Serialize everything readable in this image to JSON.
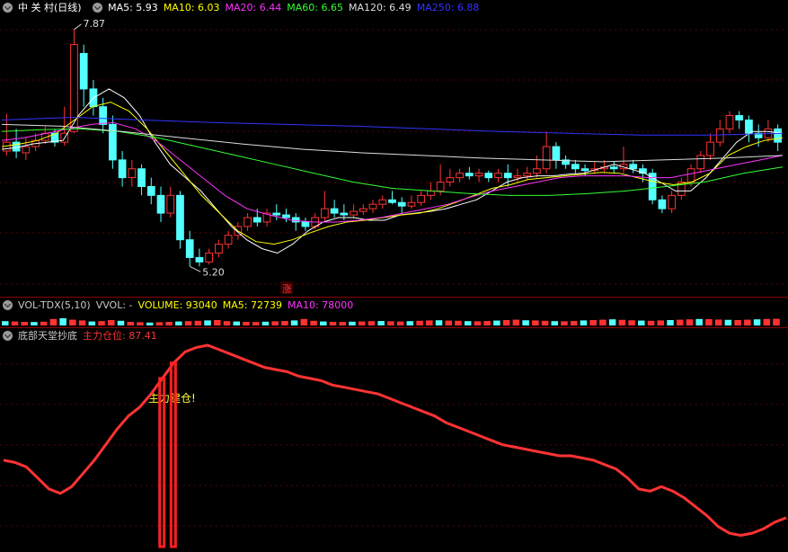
{
  "header": {
    "stock_name": "中 关 村",
    "period": "(日线)",
    "ma": [
      {
        "label": "MA5: 5.93",
        "color": "#ffffff"
      },
      {
        "label": "MA10: 6.03",
        "color": "#ffff00"
      },
      {
        "label": "MA20: 6.44",
        "color": "#ff33ff"
      },
      {
        "label": "MA60: 6.65",
        "color": "#33ff33"
      },
      {
        "label": "MA120: 6.49",
        "color": "#dddddd"
      },
      {
        "label": "MA250: 6.88",
        "color": "#3333ff"
      }
    ]
  },
  "volume_header": {
    "name": "VOL-TDX(5,10)",
    "vvol": "VVOL: -",
    "volume": "VOLUME: 93040",
    "ma5": "MA5: 72739",
    "ma10": "MA10: 78000",
    "colors": {
      "name": "#c8c8c8",
      "volume": "#ffff00",
      "ma5": "#ffff00",
      "ma10": "#ff33ff"
    }
  },
  "indicator_header": {
    "name": "底部天堂抄底",
    "series_label": "主力仓位: 87.41",
    "series_color": "#ff3333"
  },
  "annotations": {
    "high_label": "7.87",
    "low_label": "5.20",
    "signal_text": "主力建仓!",
    "zhang_badge": "涨"
  },
  "chart_data": [
    {
      "type": "candlestick",
      "title": "中 关 村 (日线)",
      "ylim": [
        4.98,
        8.0
      ],
      "candles": [
        [
          6.5,
          6.6,
          6.92,
          6.45
        ],
        [
          6.6,
          6.5,
          6.75,
          6.42
        ],
        [
          6.48,
          6.55,
          6.65,
          6.4
        ],
        [
          6.55,
          6.62,
          6.7,
          6.5
        ],
        [
          6.62,
          6.7,
          6.78,
          6.58
        ],
        [
          6.7,
          6.6,
          6.75,
          6.55
        ],
        [
          6.6,
          6.7,
          7.0,
          6.56
        ],
        [
          6.72,
          7.7,
          7.87,
          6.7
        ],
        [
          7.6,
          7.2,
          7.7,
          7.0
        ],
        [
          7.2,
          7.0,
          7.3,
          6.9
        ],
        [
          7.0,
          6.8,
          7.1,
          6.7
        ],
        [
          6.8,
          6.4,
          6.9,
          6.3
        ],
        [
          6.4,
          6.2,
          6.5,
          6.1
        ],
        [
          6.2,
          6.3,
          6.4,
          6.1
        ],
        [
          6.3,
          6.1,
          6.35,
          6.0
        ],
        [
          6.1,
          6.0,
          6.2,
          5.9
        ],
        [
          6.0,
          5.8,
          6.1,
          5.7
        ],
        [
          5.8,
          6.0,
          6.1,
          5.75
        ],
        [
          6.0,
          5.5,
          6.05,
          5.4
        ],
        [
          5.5,
          5.3,
          5.6,
          5.2
        ],
        [
          5.3,
          5.25,
          5.4,
          5.2
        ],
        [
          5.25,
          5.35,
          5.4,
          5.22
        ],
        [
          5.35,
          5.45,
          5.5,
          5.3
        ],
        [
          5.45,
          5.55,
          5.6,
          5.4
        ],
        [
          5.55,
          5.65,
          5.7,
          5.5
        ],
        [
          5.65,
          5.75,
          5.8,
          5.6
        ],
        [
          5.75,
          5.7,
          5.85,
          5.65
        ],
        [
          5.7,
          5.8,
          5.85,
          5.65
        ],
        [
          5.8,
          5.78,
          5.9,
          5.72
        ],
        [
          5.78,
          5.75,
          5.85,
          5.7
        ],
        [
          5.75,
          5.7,
          5.8,
          5.6
        ],
        [
          5.7,
          5.65,
          5.75,
          5.6
        ],
        [
          5.65,
          5.75,
          5.8,
          5.62
        ],
        [
          5.75,
          5.85,
          6.05,
          5.7
        ],
        [
          5.85,
          5.8,
          5.95,
          5.75
        ],
        [
          5.8,
          5.78,
          5.9,
          5.72
        ],
        [
          5.78,
          5.82,
          5.9,
          5.74
        ],
        [
          5.82,
          5.85,
          5.9,
          5.78
        ],
        [
          5.85,
          5.9,
          5.95,
          5.8
        ],
        [
          5.9,
          5.95,
          6.0,
          5.85
        ],
        [
          5.95,
          5.92,
          6.05,
          5.9
        ],
        [
          5.92,
          5.88,
          5.98,
          5.8
        ],
        [
          5.88,
          5.92,
          6.0,
          5.85
        ],
        [
          5.92,
          6.0,
          6.05,
          5.88
        ],
        [
          6.0,
          6.05,
          6.15,
          5.95
        ],
        [
          6.05,
          6.15,
          6.35,
          6.0
        ],
        [
          6.15,
          6.2,
          6.3,
          6.1
        ],
        [
          6.2,
          6.25,
          6.3,
          6.15
        ],
        [
          6.25,
          6.22,
          6.32,
          6.18
        ],
        [
          6.22,
          6.25,
          6.3,
          6.15
        ],
        [
          6.25,
          6.2,
          6.28,
          6.15
        ],
        [
          6.2,
          6.25,
          6.3,
          6.15
        ],
        [
          6.25,
          6.2,
          6.35,
          6.1
        ],
        [
          6.2,
          6.22,
          6.3,
          6.15
        ],
        [
          6.22,
          6.25,
          6.32,
          6.18
        ],
        [
          6.25,
          6.3,
          6.45,
          6.2
        ],
        [
          6.3,
          6.55,
          6.72,
          6.25
        ],
        [
          6.55,
          6.4,
          6.6,
          6.3
        ],
        [
          6.4,
          6.35,
          6.45,
          6.3
        ],
        [
          6.35,
          6.3,
          6.4,
          6.25
        ],
        [
          6.3,
          6.28,
          6.35,
          6.22
        ],
        [
          6.28,
          6.3,
          6.38,
          6.25
        ],
        [
          6.3,
          6.32,
          6.4,
          6.25
        ],
        [
          6.32,
          6.3,
          6.38,
          6.25
        ],
        [
          6.3,
          6.35,
          6.55,
          6.25
        ],
        [
          6.35,
          6.3,
          6.4,
          6.25
        ],
        [
          6.3,
          6.25,
          6.35,
          6.15
        ],
        [
          6.25,
          5.95,
          6.3,
          5.9
        ],
        [
          5.95,
          5.85,
          6.0,
          5.8
        ],
        [
          5.85,
          6.0,
          6.05,
          5.8
        ],
        [
          6.0,
          6.15,
          6.2,
          5.95
        ],
        [
          6.15,
          6.3,
          6.35,
          6.1
        ],
        [
          6.3,
          6.45,
          6.5,
          6.25
        ],
        [
          6.45,
          6.6,
          6.7,
          6.4
        ],
        [
          6.6,
          6.75,
          6.85,
          6.55
        ],
        [
          6.75,
          6.9,
          6.95,
          6.7
        ],
        [
          6.9,
          6.85,
          6.95,
          6.75
        ],
        [
          6.85,
          6.7,
          6.9,
          6.6
        ],
        [
          6.7,
          6.65,
          6.8,
          6.55
        ],
        [
          6.65,
          6.75,
          6.85,
          6.6
        ],
        [
          6.75,
          6.6,
          6.8,
          6.5
        ]
      ],
      "ma_series": [
        {
          "name": "MA5",
          "color": "#ffffff",
          "values": [
            6.52,
            6.54,
            6.58,
            6.6,
            6.62,
            6.9,
            7.1,
            7.2,
            7.1,
            6.9,
            6.6,
            6.35,
            6.2,
            6.05,
            5.85,
            5.65,
            5.5,
            5.4,
            5.35,
            5.45,
            5.6,
            5.7,
            5.75,
            5.75,
            5.72,
            5.72,
            5.78,
            5.8,
            5.82,
            5.85,
            5.9,
            5.95,
            6.05,
            6.15,
            6.2,
            6.22,
            6.22,
            6.24,
            6.25,
            6.3,
            6.35,
            6.3,
            6.25,
            6.15,
            6.05,
            6.05,
            6.2,
            6.4,
            6.6,
            6.72,
            6.72,
            6.7
          ]
        },
        {
          "name": "MA10",
          "color": "#ffff00",
          "values": [
            6.55,
            6.58,
            6.62,
            6.7,
            6.85,
            7.0,
            7.05,
            6.95,
            6.75,
            6.5,
            6.25,
            6.0,
            5.8,
            5.6,
            5.48,
            5.45,
            5.5,
            5.58,
            5.65,
            5.7,
            5.72,
            5.75,
            5.78,
            5.8,
            5.85,
            5.92,
            6.0,
            6.08,
            6.12,
            6.18,
            6.2,
            6.22,
            6.24,
            6.26,
            6.25,
            6.2,
            6.15,
            6.12,
            6.15,
            6.25,
            6.45,
            6.55,
            6.62,
            6.65
          ]
        },
        {
          "name": "MA20",
          "color": "#ff33ff",
          "values": [
            6.62,
            6.65,
            6.7,
            6.75,
            6.8,
            6.82,
            6.75,
            6.6,
            6.4,
            6.2,
            6.0,
            5.85,
            5.78,
            5.72,
            5.7,
            5.7,
            5.72,
            5.75,
            5.8,
            5.85,
            5.9,
            5.98,
            6.05,
            6.1,
            6.15,
            6.2,
            6.22,
            6.22,
            6.22,
            6.2,
            6.2,
            6.25,
            6.3,
            6.35,
            6.4,
            6.45
          ]
        },
        {
          "name": "MA60",
          "color": "#33ff33",
          "values": [
            6.72,
            6.74,
            6.75,
            6.72,
            6.65,
            6.55,
            6.45,
            6.35,
            6.25,
            6.15,
            6.08,
            6.05,
            6.02,
            6.0,
            6.0,
            6.02,
            6.05,
            6.1,
            6.15,
            6.25,
            6.32
          ]
        },
        {
          "name": "MA120",
          "color": "#dddddd",
          "values": [
            6.8,
            6.78,
            6.72,
            6.65,
            6.58,
            6.52,
            6.48,
            6.45,
            6.42,
            6.4,
            6.38,
            6.4,
            6.42,
            6.45
          ]
        },
        {
          "name": "MA250",
          "color": "#3333ff",
          "values": [
            6.85,
            6.88,
            6.85,
            6.82,
            6.8,
            6.78,
            6.75,
            6.72,
            6.7,
            6.68,
            6.68,
            6.7
          ]
        }
      ]
    },
    {
      "type": "bar",
      "title": "VOL-TDX(5,10)",
      "values": [
        60,
        55,
        50,
        48,
        52,
        90,
        100,
        80,
        70,
        55,
        60,
        75,
        65,
        50,
        45,
        40,
        45,
        50,
        55,
        60,
        65,
        70,
        75,
        60,
        55,
        50,
        48,
        52,
        58,
        62,
        70,
        90,
        65,
        55,
        50,
        48,
        52,
        55,
        60,
        62,
        58,
        55,
        60,
        65,
        70,
        72,
        68,
        65,
        60,
        58,
        62,
        68,
        75,
        80,
        72,
        70,
        65,
        60,
        58,
        62,
        70,
        75,
        80,
        85,
        78,
        72,
        68,
        65,
        70,
        75,
        80,
        85,
        90,
        88,
        82,
        78,
        75,
        80,
        85,
        90,
        93
      ]
    },
    {
      "type": "line",
      "title": "底部天堂抄底",
      "series": [
        {
          "name": "主力仓位",
          "color": "#ff3333",
          "values": [
            48,
            47,
            45,
            40,
            35,
            33,
            36,
            42,
            48,
            55,
            62,
            68,
            72,
            78,
            85,
            92,
            97,
            99,
            100,
            98,
            96,
            94,
            92,
            90,
            89,
            88,
            86,
            85,
            84,
            82,
            81,
            80,
            79,
            78,
            76,
            74,
            72,
            70,
            68,
            65,
            63,
            61,
            59,
            57,
            55,
            54,
            53,
            52,
            51,
            50,
            50,
            49,
            48,
            46,
            44,
            40,
            35,
            34,
            36,
            34,
            31,
            27,
            23,
            18,
            15,
            14,
            15,
            17,
            20,
            22
          ]
        }
      ],
      "signal_bars": [
        14,
        15
      ]
    }
  ]
}
